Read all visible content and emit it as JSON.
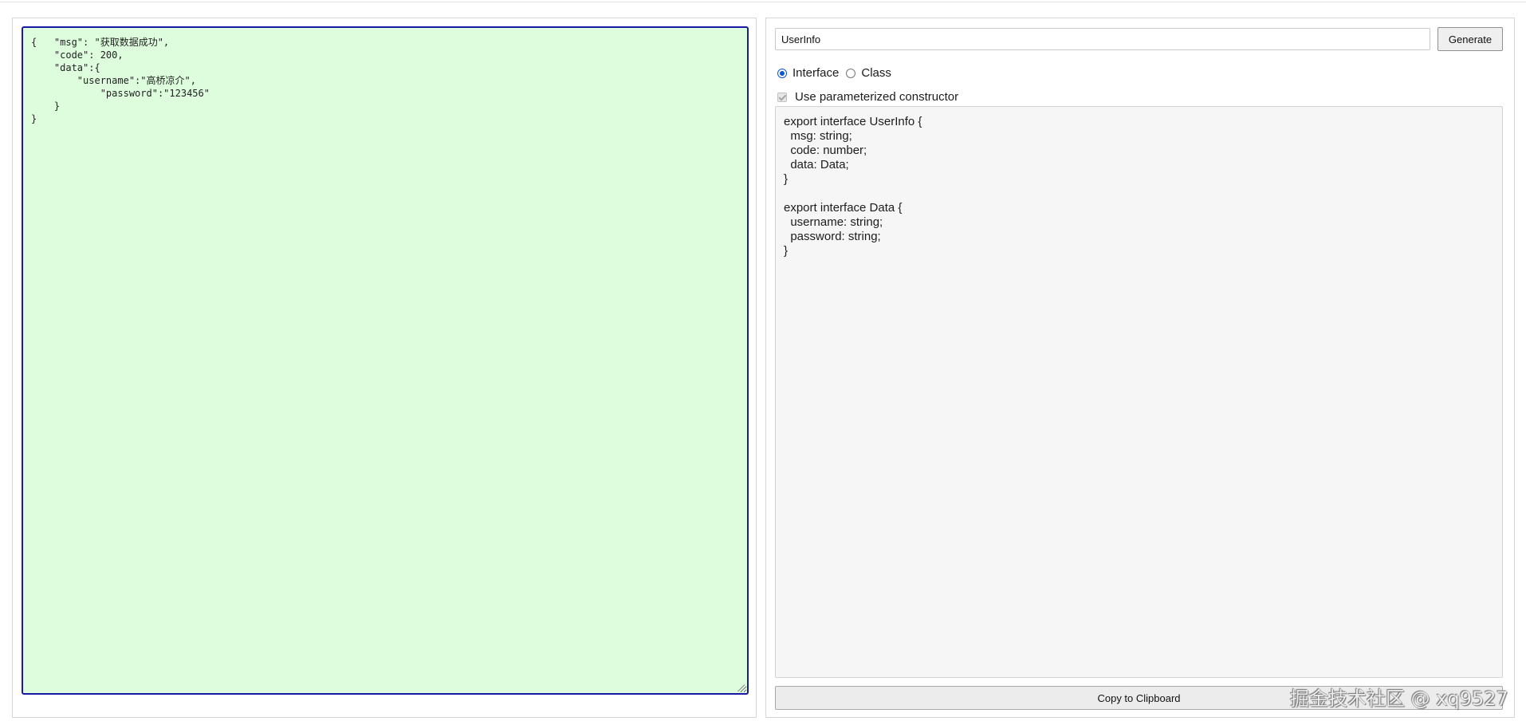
{
  "left_panel": {
    "json_input": "{   \"msg\": \"获取数据成功\",\n    \"code\": 200,\n    \"data\":{\n        \"username\":\"高桥凉介\",\n            \"password\":\"123456\"\n    }\n}"
  },
  "right_panel": {
    "name_input_value": "UserInfo",
    "generate_label": "Generate",
    "radio_interface_label": "Interface",
    "radio_class_label": "Class",
    "selected_kind": "Interface",
    "ctor_checkbox_label": "Use parameterized constructor",
    "output_code": "export interface UserInfo {\n  msg: string;\n  code: number;\n  data: Data;\n}\n\nexport interface Data {\n  username: string;\n  password: string;\n}",
    "copy_label": "Copy to Clipboard"
  },
  "watermark_text": "掘金技术社区 @ xq9527",
  "colors": {
    "editor_background": "#ddfddd",
    "editor_border": "#1a1aa6",
    "output_background": "#f6f6f6",
    "radio_accent": "#0b57d0"
  }
}
